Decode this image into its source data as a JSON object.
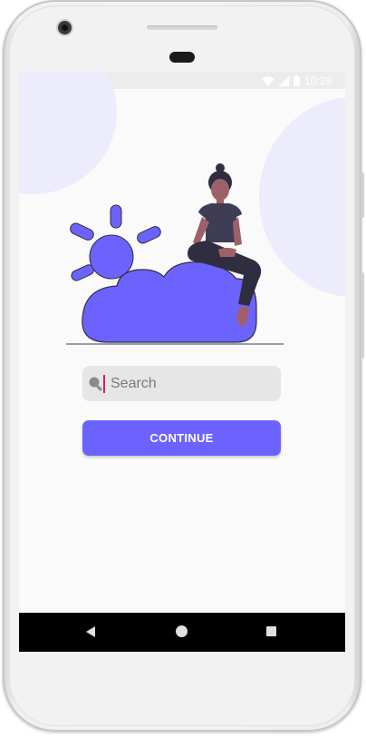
{
  "status_bar": {
    "time": "10:39",
    "icons": [
      "sd-card-icon",
      "wifi-icon",
      "signal-icon",
      "battery-icon"
    ]
  },
  "search": {
    "placeholder": "Search",
    "icon": "search-icon"
  },
  "continue_button": {
    "label": "CONTINUE"
  },
  "nav_bar": {
    "buttons": [
      "back-icon",
      "home-icon",
      "recents-icon"
    ]
  },
  "colors": {
    "accent": "#6c63ff",
    "blob": "#ececfc",
    "caret": "#d81b60",
    "skin": "#9e616a",
    "hair": "#2f2e41",
    "shirt": "#3f3d56"
  }
}
